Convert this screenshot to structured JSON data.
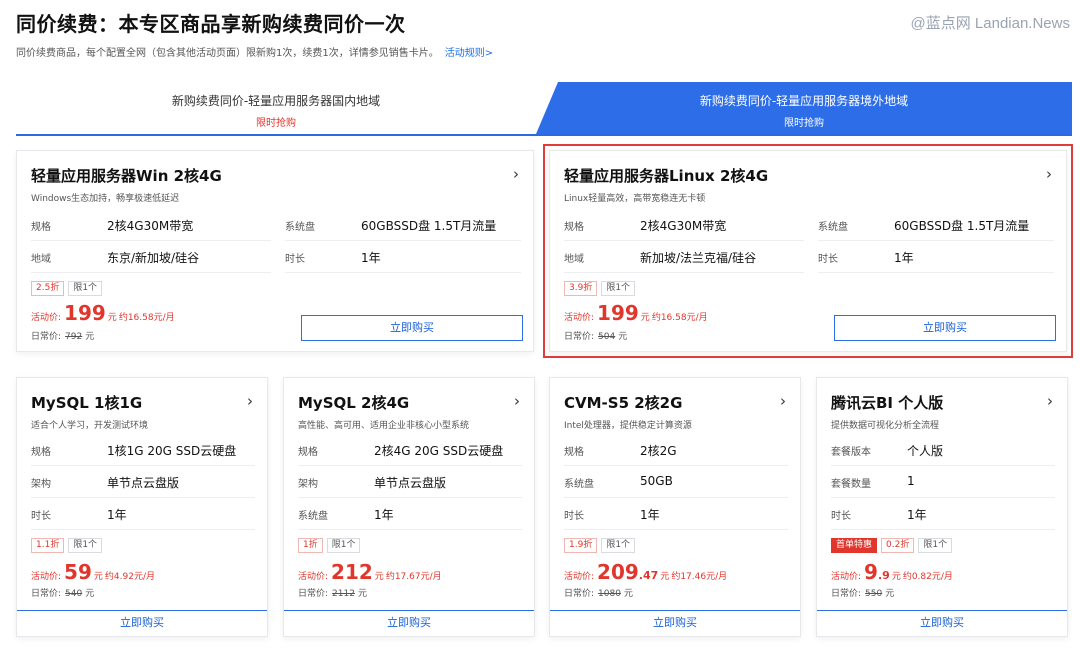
{
  "header": {
    "title": "同价续费：本专区商品享新购续费同价一次",
    "watermark": "@蓝点网 Landian.News",
    "subtitle": "同价续费商品，每个配置全网（包含其他活动页面）限新购1次，续费1次，详情参见销售卡片。",
    "rule_link": "活动规则>"
  },
  "tabs": [
    {
      "title": "新购续费同价-轻量应用服务器国内地域",
      "sub": "限时抢购"
    },
    {
      "title": "新购续费同价-轻量应用服务器境外地域",
      "sub": "限时抢购"
    }
  ],
  "common": {
    "price_label": "活动价:",
    "orig_label": "日常价:",
    "currency": "元",
    "buy": "立即购买",
    "limit": "限1个",
    "chevron": "›"
  },
  "cards_top": [
    {
      "title": "轻量应用服务器Win 2核4G",
      "desc": "Windows生态加持，畅享极速低延迟",
      "specs": [
        {
          "label": "规格",
          "value": "2核4G30M带宽"
        },
        {
          "label": "系统盘",
          "value": "60GBSSD盘 1.5T月流量"
        },
        {
          "label": "地域",
          "value": "东京/新加坡/硅谷"
        },
        {
          "label": "时长",
          "value": "1年"
        }
      ],
      "discount": "2.5折",
      "price": "199",
      "monthly": "约16.58元/月",
      "orig": "792"
    },
    {
      "title": "轻量应用服务器Linux 2核4G",
      "desc": "Linux轻量高效，高带宽稳连无卡顿",
      "specs": [
        {
          "label": "规格",
          "value": "2核4G30M带宽"
        },
        {
          "label": "系统盘",
          "value": "60GBSSD盘 1.5T月流量"
        },
        {
          "label": "地域",
          "value": "新加坡/法兰克福/硅谷"
        },
        {
          "label": "时长",
          "value": "1年"
        }
      ],
      "discount": "3.9折",
      "price": "199",
      "monthly": "约16.58元/月",
      "orig": "504"
    }
  ],
  "cards_bottom": [
    {
      "title": "MySQL 1核1G",
      "desc": "适合个人学习，开发测试环境",
      "specs": [
        {
          "label": "规格",
          "value": "1核1G 20G SSD云硬盘"
        },
        {
          "label": "架构",
          "value": "单节点云盘版"
        },
        {
          "label": "时长",
          "value": "1年"
        }
      ],
      "special": "",
      "discount": "1.1折",
      "price": "59",
      "price_dec": "",
      "monthly": "约4.92元/月",
      "orig": "540"
    },
    {
      "title": "MySQL 2核4G",
      "desc": "高性能、高可用、适用企业非核心小型系统",
      "specs": [
        {
          "label": "规格",
          "value": "2核4G 20G SSD云硬盘"
        },
        {
          "label": "架构",
          "value": "单节点云盘版"
        },
        {
          "label": "系统盘",
          "value": "1年"
        }
      ],
      "special": "",
      "discount": "1折",
      "price": "212",
      "price_dec": "",
      "monthly": "约17.67元/月",
      "orig": "2112"
    },
    {
      "title": "CVM-S5 2核2G",
      "desc": "Intel处理器，提供稳定计算资源",
      "specs": [
        {
          "label": "规格",
          "value": "2核2G"
        },
        {
          "label": "系统盘",
          "value": "50GB"
        },
        {
          "label": "时长",
          "value": "1年"
        }
      ],
      "special": "",
      "discount": "1.9折",
      "price": "209",
      "price_dec": ".47",
      "monthly": "约17.46元/月",
      "orig": "1080"
    },
    {
      "title": "腾讯云BI 个人版",
      "desc": "提供数据可视化分析全流程",
      "specs": [
        {
          "label": "套餐版本",
          "value": "个人版"
        },
        {
          "label": "套餐数量",
          "value": "1"
        },
        {
          "label": "时长",
          "value": "1年"
        }
      ],
      "special": "首单特惠",
      "discount": "0.2折",
      "price": "9",
      "price_dec": ".9",
      "monthly": "约0.82元/月",
      "orig": "550"
    }
  ]
}
